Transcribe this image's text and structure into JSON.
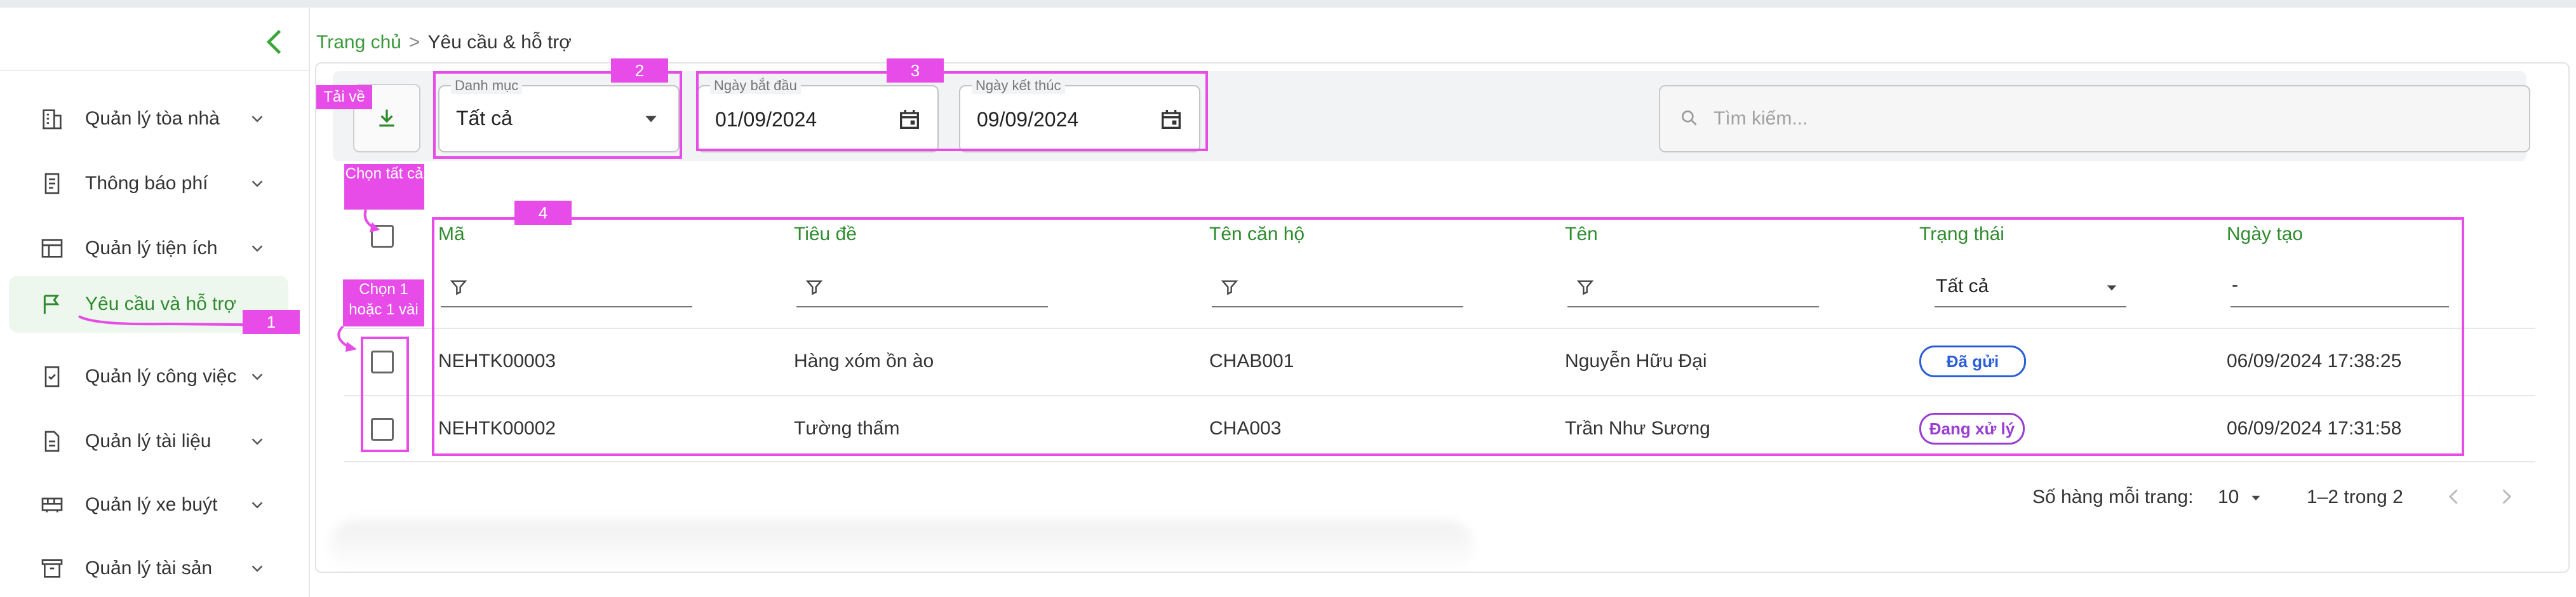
{
  "breadcrumb": {
    "home": "Trang chủ",
    "separator": ">",
    "current": "Yêu cầu & hỗ trợ"
  },
  "sidebar": {
    "items": [
      {
        "label": "Quản lý tòa nhà",
        "icon": "building-icon"
      },
      {
        "label": "Thông báo phí",
        "icon": "receipt-icon"
      },
      {
        "label": "Quản lý tiện ích",
        "icon": "layout-icon"
      },
      {
        "label": "Yêu cầu và hỗ trợ",
        "icon": "flag-icon",
        "active": true
      },
      {
        "label": "Quản lý công việc",
        "icon": "task-icon"
      },
      {
        "label": "Quản lý tài liệu",
        "icon": "document-icon"
      },
      {
        "label": "Quản lý xe buýt",
        "icon": "bus-icon"
      },
      {
        "label": "Quản lý tài sản",
        "icon": "archive-icon"
      }
    ]
  },
  "toolbar": {
    "download_tag": "Tải về",
    "category_label": "Danh mục",
    "category_value": "Tất cả",
    "start_label": "Ngày bắt đầu",
    "start_value": "01/09/2024",
    "end_label": "Ngày kết thúc",
    "end_value": "09/09/2024",
    "search_placeholder": "Tìm kiếm..."
  },
  "table": {
    "columns": [
      "Mã",
      "Tiêu đề",
      "Tên căn hộ",
      "Tên",
      "Trạng thái",
      "Ngày tạo"
    ],
    "status_filter": "Tất cả",
    "date_filter": "-",
    "rows": [
      {
        "code": "NEHTK00003",
        "title": "Hàng xóm ồn ào",
        "apartment": "CHAB001",
        "name": "Nguyễn Hữu Đại",
        "status": "Đã gửi",
        "created": "06/09/2024 17:38:25"
      },
      {
        "code": "NEHTK00002",
        "title": "Tường thấm",
        "apartment": "CHA003",
        "name": "Trần Như Sương",
        "status": "Đang xử lý",
        "created": "06/09/2024 17:31:58"
      }
    ]
  },
  "pagination": {
    "rows_label": "Số hàng mỗi trang:",
    "rows_value": "10",
    "range": "1–2 trong 2"
  },
  "annotations": {
    "n1": "1",
    "n2": "2",
    "n3": "3",
    "n4": "4",
    "select_all": "Chọn tất cả",
    "select_some": "Chọn 1 hoặc 1 vài"
  },
  "colors": {
    "accent": "#2e8b2e",
    "annotation": "#e84ce8",
    "sent": "#2b5fd9",
    "processing": "#9b3dd0"
  }
}
